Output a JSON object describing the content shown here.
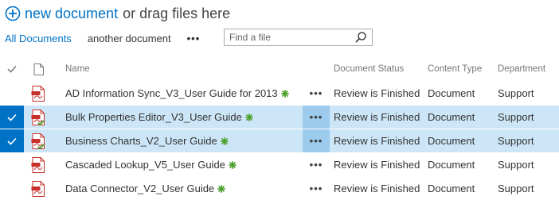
{
  "toolbar": {
    "new_document_label": "new document",
    "drag_text": "or drag files here"
  },
  "views": {
    "active": "All Documents",
    "other": "another document",
    "more": "•••"
  },
  "search": {
    "placeholder": "Find a file",
    "value": ""
  },
  "columns": {
    "name": "Name",
    "status": "Document Status",
    "content_type": "Content Type",
    "department": "Department"
  },
  "row_ellipsis": "•••",
  "rows": [
    {
      "name": "AD Information Sync_V3_User Guide for 2013",
      "status": "Review is Finished",
      "content_type": "Document",
      "department": "Support",
      "selected": false,
      "icon": "pdf-icon"
    },
    {
      "name": "Bulk Properties Editor_V3_User Guide",
      "status": "Review is Finished",
      "content_type": "Document",
      "department": "Support",
      "selected": true,
      "icon": "pdf-icon"
    },
    {
      "name": "Business Charts_V2_User Guide",
      "status": "Review is Finished",
      "content_type": "Document",
      "department": "Support",
      "selected": true,
      "icon": "pdf-icon"
    },
    {
      "name": "Cascaded Lookup_V5_User Guide",
      "status": "Review is Finished",
      "content_type": "Document",
      "department": "Support",
      "selected": false,
      "icon": "pdf-icon"
    },
    {
      "name": "Data Connector_V2_User Guide",
      "status": "Review is Finished",
      "content_type": "Document",
      "department": "Support",
      "selected": false,
      "icon": "pdf-icon"
    }
  ],
  "colors": {
    "accent": "#0072c6",
    "selected_row": "#cde6f7",
    "new_mark": "#4a9e29",
    "pdf_red": "#c8312b"
  }
}
